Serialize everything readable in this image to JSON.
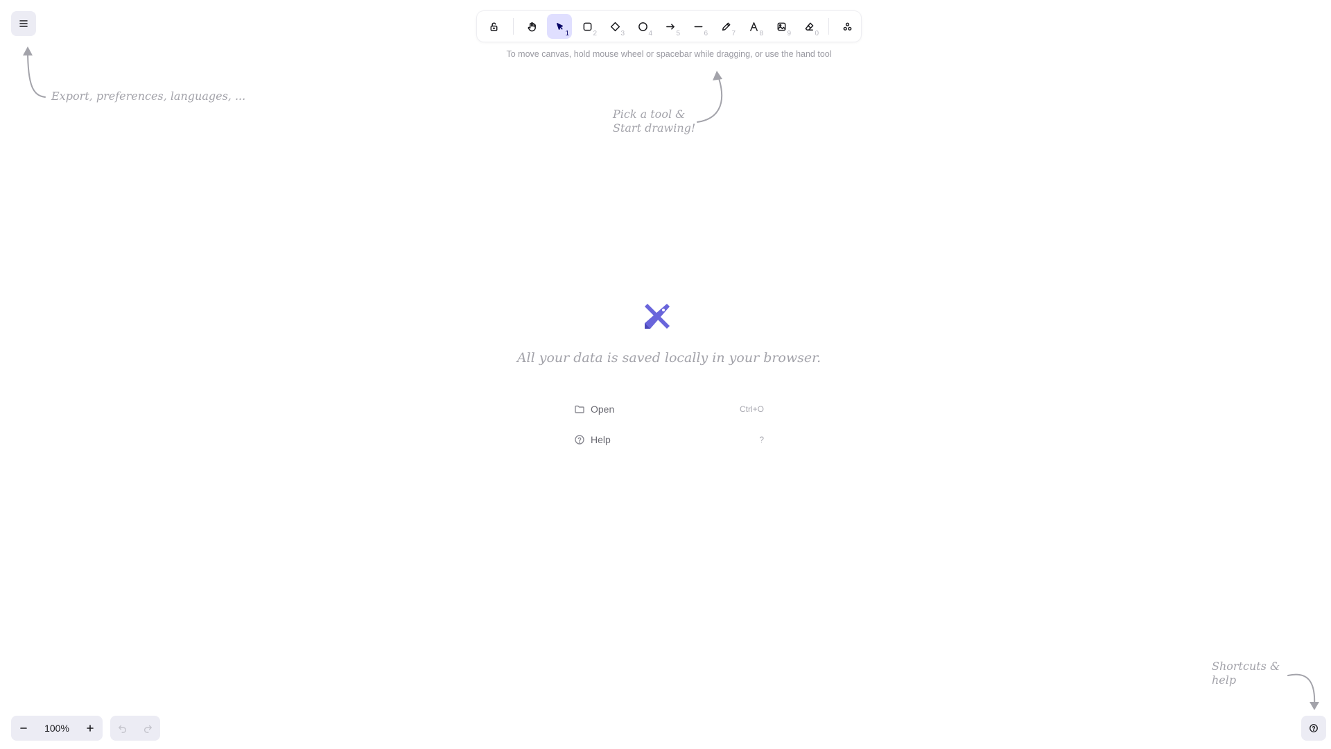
{
  "menu": {
    "icon": "hamburger-icon"
  },
  "toolbar": {
    "lock": {
      "icon": "lock-icon"
    },
    "tools": [
      {
        "name": "hand",
        "icon": "hand-icon",
        "key": ""
      },
      {
        "name": "selection",
        "icon": "pointer-icon",
        "key": "1",
        "active": true
      },
      {
        "name": "rectangle",
        "icon": "rectangle-icon",
        "key": "2"
      },
      {
        "name": "diamond",
        "icon": "diamond-icon",
        "key": "3"
      },
      {
        "name": "ellipse",
        "icon": "ellipse-icon",
        "key": "4"
      },
      {
        "name": "arrow",
        "icon": "arrow-icon",
        "key": "5"
      },
      {
        "name": "line",
        "icon": "line-icon",
        "key": "6"
      },
      {
        "name": "draw",
        "icon": "pencil-icon",
        "key": "7"
      },
      {
        "name": "text",
        "icon": "text-icon",
        "key": "8"
      },
      {
        "name": "image",
        "icon": "image-icon",
        "key": "9"
      },
      {
        "name": "eraser",
        "icon": "eraser-icon",
        "key": "0"
      }
    ],
    "extra": {
      "icon": "shapes-library-icon"
    }
  },
  "hint": "To move canvas, hold mouse wheel or spacebar while dragging, or use the hand tool",
  "notes": {
    "menu": "Export, preferences, languages, ...",
    "tool_line1": "Pick a tool &",
    "tool_line2": "Start drawing!",
    "help_line1": "Shortcuts &",
    "help_line2": "help"
  },
  "welcome": {
    "message": "All your data is saved locally in your browser.",
    "items": [
      {
        "label": "Open",
        "shortcut": "Ctrl+O",
        "icon": "folder-icon"
      },
      {
        "label": "Help",
        "shortcut": "?",
        "icon": "help-circle-icon"
      }
    ]
  },
  "zoom": {
    "value": "100%",
    "out_icon": "minus-icon",
    "in_icon": "plus-icon"
  },
  "history": {
    "undo_icon": "undo-icon",
    "redo_icon": "redo-icon"
  },
  "colors": {
    "accent": "#6965db",
    "active_tool_bg": "#e0dfff",
    "island_bg": "#ececf4"
  }
}
